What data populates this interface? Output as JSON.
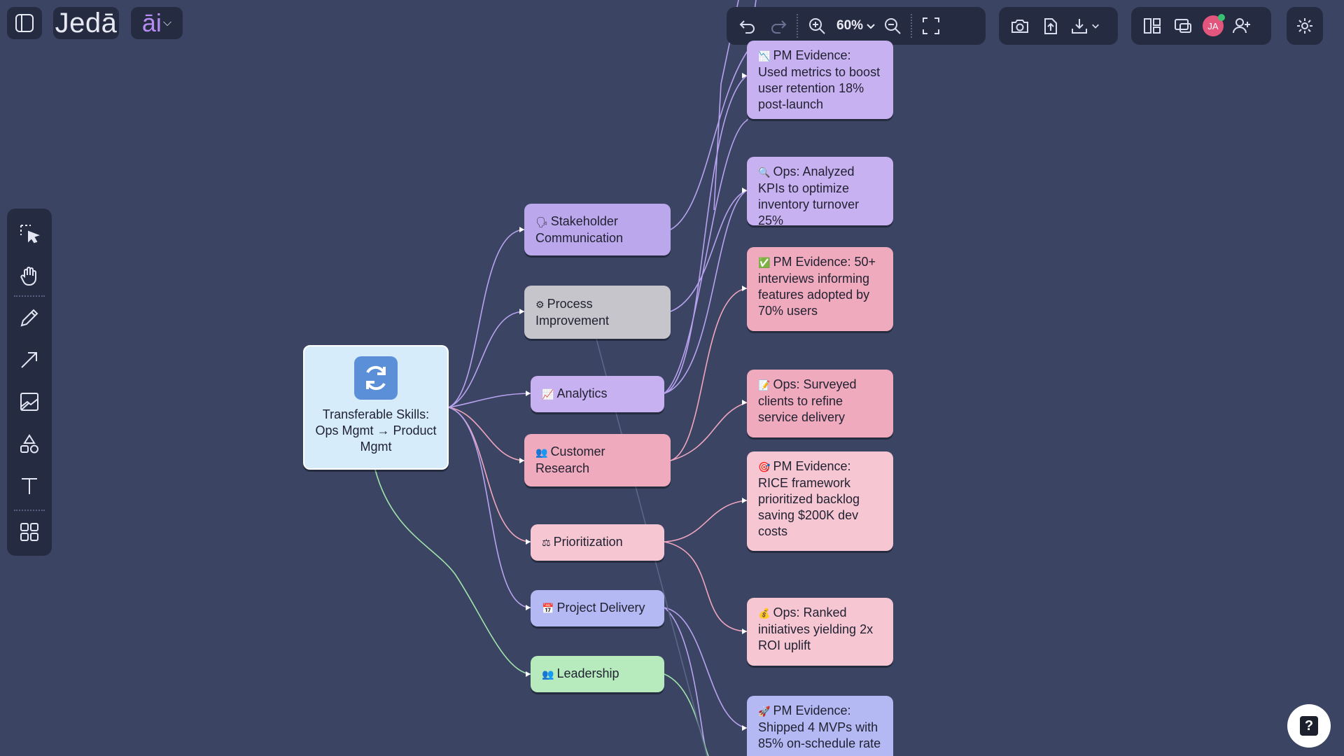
{
  "app": {
    "logo_text": "Jedā",
    "ai_menu_label": "āi",
    "zoom_label": "60%",
    "avatar_initials": "JA"
  },
  "colors": {
    "background": "#3b4463",
    "toolbar": "#252b41",
    "accent": "#b68cf2",
    "connector_purple": "#b9a3f0",
    "connector_pink": "#f0a6bf",
    "connector_green": "#9fe3aa"
  },
  "toolbar": {
    "history": [
      "undo-icon",
      "redo-icon"
    ],
    "zoom": [
      "zoom-in-icon",
      "zoom-out-icon",
      "fit-screen-icon"
    ],
    "export": [
      "camera-icon",
      "upload-icon",
      "download-icon"
    ],
    "view": [
      "layout-panels-icon",
      "present-icon",
      "add-user-icon"
    ],
    "settings": "gear-icon"
  },
  "left_tools": [
    "select-icon",
    "hand-icon",
    "pencil-icon",
    "arrow-icon",
    "image-icon",
    "shapes-icon",
    "text-icon",
    "grid-icon"
  ],
  "mindmap": {
    "root": {
      "icon": "refresh-icon",
      "label": "Transferable Skills: Ops Mgmt → Product Mgmt"
    },
    "branches": [
      {
        "emoji": "🗣",
        "label": "Stakeholder Communication"
      },
      {
        "emoji": "⚙",
        "label": "Process Improvement"
      },
      {
        "emoji": "📈",
        "label": "Analytics"
      },
      {
        "emoji": "👥",
        "label": "Customer Research"
      },
      {
        "emoji": "⚖",
        "label": "Prioritization"
      },
      {
        "emoji": "📅",
        "label": "Project Delivery"
      },
      {
        "emoji": "👥",
        "label": "Leadership"
      }
    ],
    "evidence": [
      {
        "emoji": "📉",
        "label": "PM Evidence: Used metrics to boost user retention 18% post-launch"
      },
      {
        "emoji": "🔍",
        "label": "Ops: Analyzed KPIs to optimize inventory turnover 25%"
      },
      {
        "emoji": "✅",
        "label": "PM Evidence: 50+ interviews informing features adopted by 70% users"
      },
      {
        "emoji": "📝",
        "label": "Ops: Surveyed clients to refine service delivery"
      },
      {
        "emoji": "🎯",
        "label": "PM Evidence: RICE framework prioritized backlog saving $200K dev costs"
      },
      {
        "emoji": "💰",
        "label": "Ops: Ranked initiatives yielding 2x ROI uplift"
      },
      {
        "emoji": "🚀",
        "label": "PM Evidence: Shipped 4 MVPs with 85% on-schedule rate"
      }
    ]
  },
  "help": {
    "label": "?"
  }
}
